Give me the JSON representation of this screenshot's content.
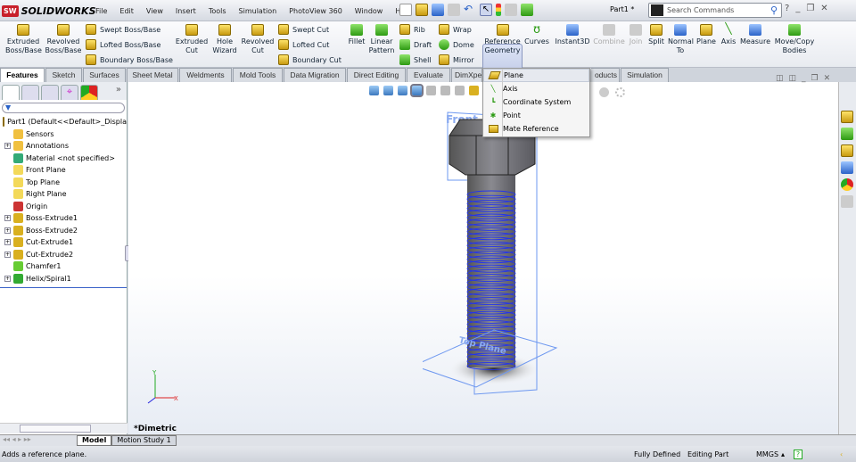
{
  "app": {
    "name": "SOLIDWORKS",
    "logo_mark": "SW",
    "document_title": "Part1 *"
  },
  "menu": [
    "File",
    "Edit",
    "View",
    "Insert",
    "Tools",
    "Simulation",
    "PhotoView 360",
    "Window",
    "Help"
  ],
  "search": {
    "placeholder": "Search Commands"
  },
  "ribbon": {
    "extruded_boss": "Extruded Boss/Base",
    "revolved_boss": "Revolved Boss/Base",
    "swept_boss": "Swept Boss/Base",
    "lofted_boss": "Lofted Boss/Base",
    "boundary_boss": "Boundary Boss/Base",
    "extruded_cut": "Extruded Cut",
    "hole_wizard": "Hole Wizard",
    "revolved_cut": "Revolved Cut",
    "swept_cut": "Swept Cut",
    "lofted_cut": "Lofted Cut",
    "boundary_cut": "Boundary Cut",
    "fillet": "Fillet",
    "linear_pattern": "Linear Pattern",
    "rib": "Rib",
    "draft": "Draft",
    "shell": "Shell",
    "wrap": "Wrap",
    "dome": "Dome",
    "mirror": "Mirror",
    "reference_geometry": "Reference Geometry",
    "curves": "Curves",
    "instant3d": "Instant3D",
    "combine": "Combine",
    "join": "Join",
    "split": "Split",
    "normal_to": "Normal To",
    "plane": "Plane",
    "axis": "Axis",
    "measure": "Measure",
    "move_copy": "Move/Copy Bodies"
  },
  "tabs": [
    "Features",
    "Sketch",
    "Surfaces",
    "Sheet Metal",
    "Weldments",
    "Mold Tools",
    "Data Migration",
    "Direct Editing",
    "Evaluate",
    "DimXpert",
    "SW Products",
    "Simulation"
  ],
  "tabs_visible": {
    "dimxpert": "DimXpe",
    "products": "oducts"
  },
  "dropdown": [
    "Plane",
    "Axis",
    "Coordinate System",
    "Point",
    "Mate Reference"
  ],
  "tree": {
    "root": "Part1  (Default<<Default>_Displa",
    "items": [
      {
        "label": "Sensors",
        "exp": false,
        "color": "#f0c040"
      },
      {
        "label": "Annotations",
        "exp": true,
        "color": "#f0c040"
      },
      {
        "label": "Material <not specified>",
        "exp": false,
        "color": "#3a7"
      },
      {
        "label": "Front Plane",
        "exp": false,
        "color": "#f3d95a"
      },
      {
        "label": "Top Plane",
        "exp": false,
        "color": "#f3d95a"
      },
      {
        "label": "Right Plane",
        "exp": false,
        "color": "#f3d95a"
      },
      {
        "label": "Origin",
        "exp": false,
        "color": "#c33"
      },
      {
        "label": "Boss-Extrude1",
        "exp": true,
        "color": "#d9b020"
      },
      {
        "label": "Boss-Extrude2",
        "exp": true,
        "color": "#d9b020"
      },
      {
        "label": "Cut-Extrude1",
        "exp": true,
        "color": "#d9b020"
      },
      {
        "label": "Cut-Extrude2",
        "exp": true,
        "color": "#d9b020"
      },
      {
        "label": "Chamfer1",
        "exp": false,
        "color": "#6c3"
      },
      {
        "label": "Helix/Spiral1",
        "exp": true,
        "color": "#3a3"
      }
    ]
  },
  "viewport": {
    "view_label": "*Dimetric",
    "front_plane_label": "Front",
    "top_plane_label": "Top Plane"
  },
  "bottom_tabs": [
    "Model",
    "Motion Study 1"
  ],
  "status": {
    "message": "Adds a reference plane.",
    "state": "Fully Defined",
    "mode": "Editing Part",
    "units": "MMGS"
  }
}
